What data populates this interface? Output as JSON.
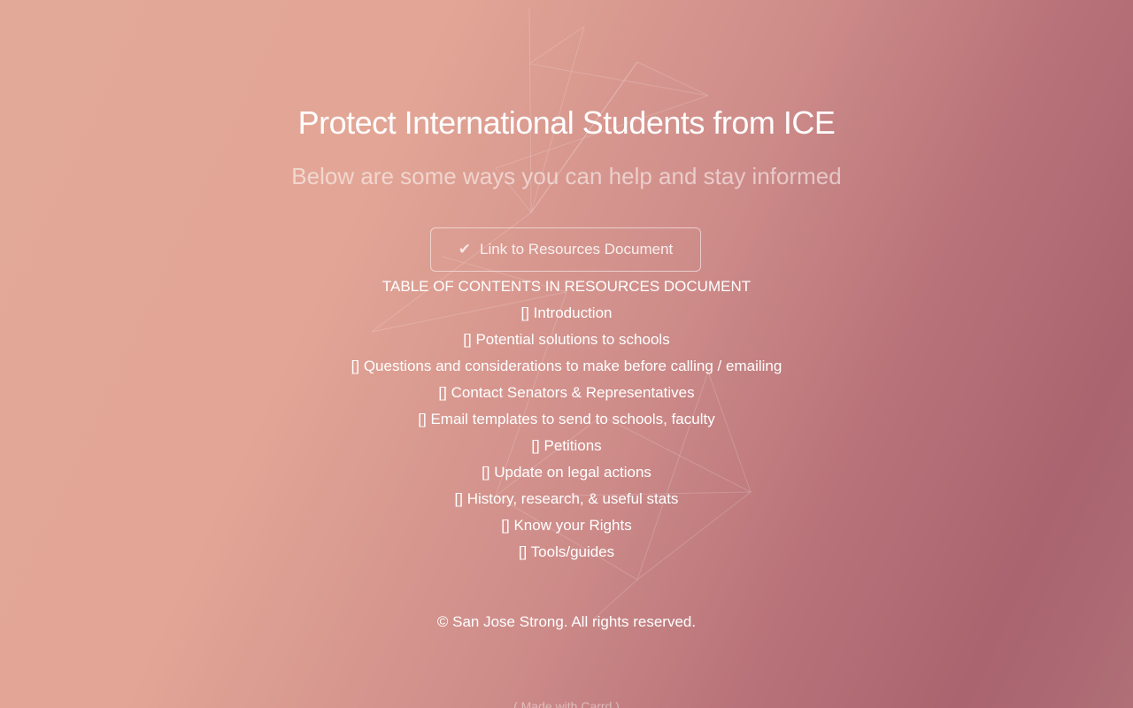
{
  "page": {
    "title": "Protect International Students from ICE",
    "subtitle": "Below are some ways you can help and stay informed"
  },
  "button": {
    "label": "Link to Resources Document",
    "icon": "checkmark-icon"
  },
  "toc": {
    "heading": "TABLE OF CONTENTS IN RESOURCES DOCUMENT",
    "items": [
      "[] Introduction",
      "[] Potential solutions to schools",
      "[] Questions and considerations to make before calling / emailing",
      "[] Contact Senators & Representatives",
      "[] Email templates to send to schools, faculty",
      "[] Petitions",
      "[] Update on legal actions",
      "[] History, research, & useful stats",
      "[] Know your Rights",
      "[] Tools/guides"
    ]
  },
  "footer": {
    "copyright": "© San Jose Strong. All rights reserved.",
    "made_with": "( Made with Carrd )"
  },
  "colors": {
    "gradient_start": "#e2a898",
    "gradient_end": "#a9646f",
    "text": "#ffffff"
  }
}
